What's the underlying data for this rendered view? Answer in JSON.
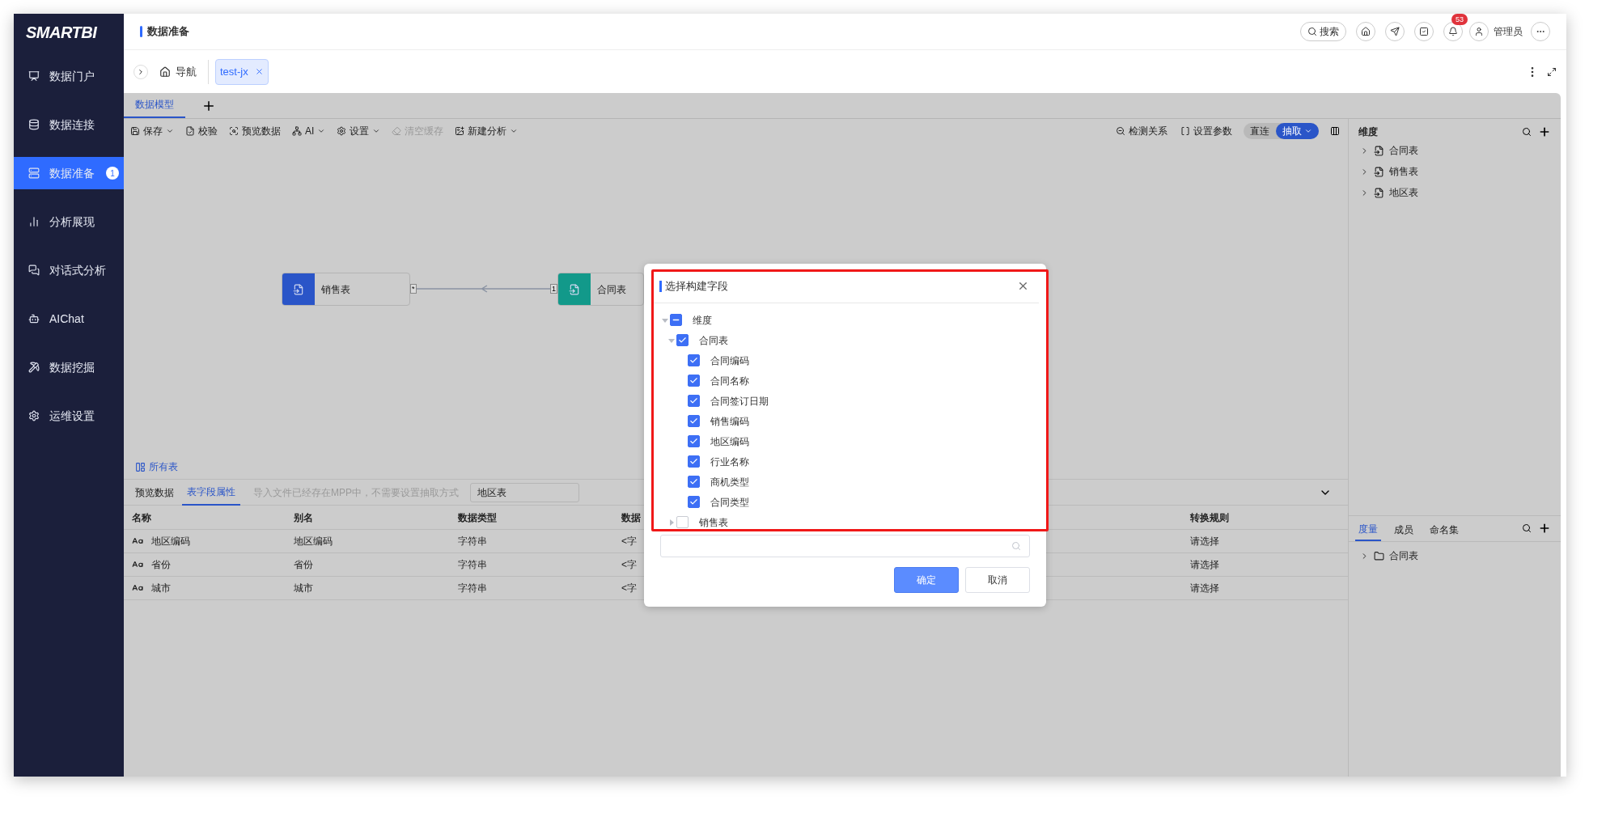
{
  "sidebar": {
    "logo": "SMARTBI",
    "items": [
      {
        "label": "数据门户",
        "selected": false
      },
      {
        "label": "数据连接",
        "selected": false
      },
      {
        "label": "数据准备",
        "selected": true,
        "badge": "1"
      },
      {
        "label": "分析展现",
        "selected": false
      },
      {
        "label": "对话式分析",
        "selected": false
      },
      {
        "label": "AIChat",
        "selected": false
      },
      {
        "label": "数据挖掘",
        "selected": false
      },
      {
        "label": "运维设置",
        "selected": false
      }
    ]
  },
  "header": {
    "title": "数据准备",
    "search": "搜索",
    "notifications": "53",
    "user": "管理员"
  },
  "tabs_bar": {
    "nav": "导航",
    "tabs": [
      {
        "label": "test-jx",
        "selected": true
      }
    ]
  },
  "model_tabs": [
    {
      "label": "数据模型",
      "selected": true
    }
  ],
  "toolbar": {
    "left": [
      {
        "label": "保存",
        "dropdown": true,
        "disabled": false
      },
      {
        "label": "校验",
        "dropdown": false,
        "disabled": false
      },
      {
        "label": "预览数据",
        "dropdown": false,
        "disabled": false
      },
      {
        "label": "AI",
        "dropdown": true,
        "disabled": false
      },
      {
        "label": "设置",
        "dropdown": true,
        "disabled": false
      },
      {
        "label": "清空缓存",
        "dropdown": false,
        "disabled": true
      },
      {
        "label": "新建分析",
        "dropdown": true,
        "disabled": false
      }
    ],
    "right": [
      "检测关系",
      "设置参数"
    ],
    "mode": [
      {
        "label": "直连",
        "selected": false
      },
      {
        "label": "抽取",
        "selected": true
      }
    ]
  },
  "canvas": {
    "nodes": [
      {
        "label": "销售表",
        "color": "#2a55c8"
      },
      {
        "label": "合同表",
        "color": "#12998a"
      }
    ],
    "link": {
      "from_mark": "*",
      "to_mark": "1"
    }
  },
  "bottom": {
    "all_tables": "所有表",
    "tabs": [
      {
        "label": "预览数据",
        "selected": false
      },
      {
        "label": "表字段属性",
        "selected": true
      }
    ],
    "notice": "导入文件已经存在MPP中，不需要设置抽取方式",
    "table_name": "地区表",
    "table": {
      "columns": [
        "名称",
        "别名",
        "数据类型",
        "数据",
        "转换规则"
      ],
      "rows": [
        [
          "地区编码",
          "地区编码",
          "字符串",
          "<字",
          "请选择"
        ],
        [
          "省份",
          "省份",
          "字符串",
          "<字",
          "请选择"
        ],
        [
          "城市",
          "城市",
          "字符串",
          "<字",
          "请选择"
        ]
      ]
    }
  },
  "right_panel": {
    "title": "维度",
    "items": [
      "合同表",
      "销售表",
      "地区表"
    ],
    "tabs": [
      {
        "label": "度量",
        "selected": true
      },
      {
        "label": "成员",
        "selected": false
      },
      {
        "label": "命名集",
        "selected": false
      }
    ],
    "measure_items": [
      "合同表"
    ]
  },
  "dialog": {
    "title": "选择构建字段",
    "tree": [
      {
        "label": "维度",
        "checked": true,
        "partial": true,
        "expanded": true,
        "children": [
          {
            "label": "合同表",
            "checked": true,
            "expanded": true,
            "children": [
              {
                "label": "合同编码",
                "checked": true
              },
              {
                "label": "合同名称",
                "checked": true
              },
              {
                "label": "合同签订日期",
                "checked": true
              },
              {
                "label": "销售编码",
                "checked": true
              },
              {
                "label": "地区编码",
                "checked": true
              },
              {
                "label": "行业名称",
                "checked": true
              },
              {
                "label": "商机类型",
                "checked": true
              },
              {
                "label": "合同类型",
                "checked": true
              }
            ]
          },
          {
            "label": "销售表",
            "checked": false,
            "expanded": false
          }
        ]
      }
    ],
    "buttons": [
      {
        "label": "确定",
        "kind": "primary"
      },
      {
        "label": "取消",
        "kind": "secondary"
      }
    ]
  }
}
